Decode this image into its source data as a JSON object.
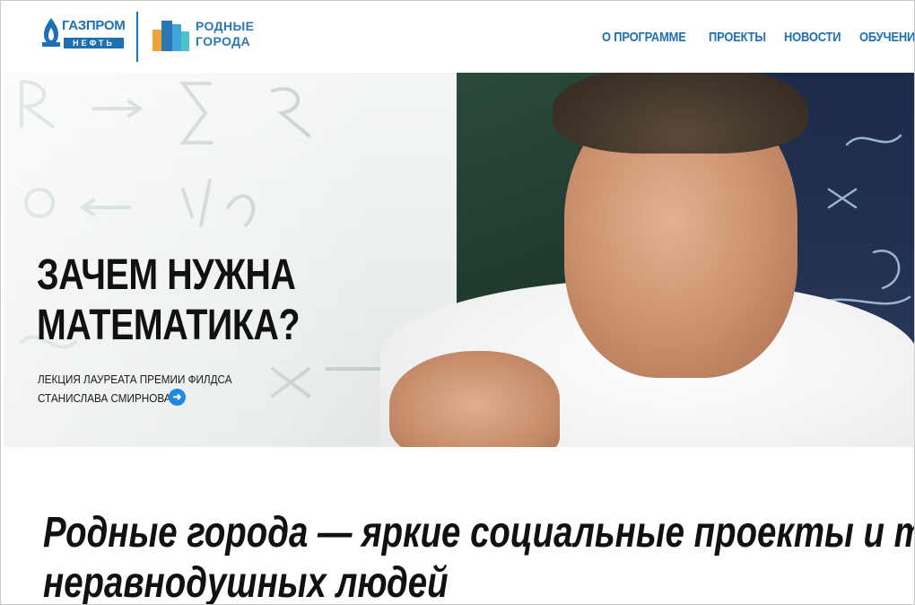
{
  "header": {
    "logo_gazprom_word": "ГАЗПРОМ",
    "logo_gazprom_sub": "НЕФТЬ",
    "logo_rg_line1": "РОДНЫЕ",
    "logo_rg_line2": "ГОРОДА",
    "nav": [
      "О ПРОГРАММЕ",
      "ПРОЕКТЫ",
      "НОВОСТИ",
      "ОБУЧЕНИЕ"
    ]
  },
  "hero": {
    "title_line1": "ЗАЧЕМ НУЖНА",
    "title_line2": "МАТЕМАТИКА?",
    "subtitle_line1": "ЛЕКЦИЯ ЛАУРЕАТА ПРЕМИИ ФИЛДСА",
    "subtitle_line2": "СТАНИСЛАВА СМИРНОВА",
    "arrow_icon": "arrow-right-icon"
  },
  "tagline": {
    "line1": "Родные города — яркие социальные проекты и т",
    "line2": "неравнодушных людей"
  },
  "colors": {
    "brand_blue": "#1f6fb5",
    "accent_blue": "#1e88e5",
    "text_dark": "#111111"
  }
}
